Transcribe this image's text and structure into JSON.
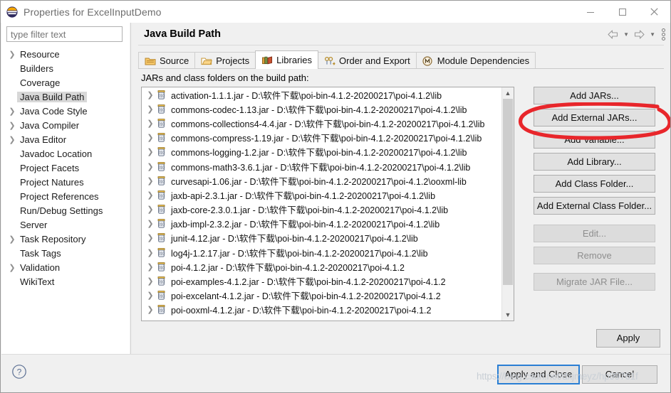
{
  "window": {
    "title": "Properties for ExcelInputDemo",
    "app_icon": "eclipse-icon",
    "minimize_label": "–",
    "maximize_label": "□",
    "close_label": "×"
  },
  "sidebar": {
    "filter_placeholder": "type filter text",
    "filter_value": "",
    "items": [
      {
        "label": "Resource",
        "expandable": true,
        "selected": false
      },
      {
        "label": "Builders",
        "expandable": false,
        "selected": false
      },
      {
        "label": "Coverage",
        "expandable": false,
        "selected": false
      },
      {
        "label": "Java Build Path",
        "expandable": false,
        "selected": true
      },
      {
        "label": "Java Code Style",
        "expandable": true,
        "selected": false
      },
      {
        "label": "Java Compiler",
        "expandable": true,
        "selected": false
      },
      {
        "label": "Java Editor",
        "expandable": true,
        "selected": false
      },
      {
        "label": "Javadoc Location",
        "expandable": false,
        "selected": false
      },
      {
        "label": "Project Facets",
        "expandable": false,
        "selected": false
      },
      {
        "label": "Project Natures",
        "expandable": false,
        "selected": false
      },
      {
        "label": "Project References",
        "expandable": false,
        "selected": false
      },
      {
        "label": "Run/Debug Settings",
        "expandable": false,
        "selected": false
      },
      {
        "label": "Server",
        "expandable": false,
        "selected": false
      },
      {
        "label": "Task Repository",
        "expandable": true,
        "selected": false
      },
      {
        "label": "Task Tags",
        "expandable": false,
        "selected": false
      },
      {
        "label": "Validation",
        "expandable": true,
        "selected": false
      },
      {
        "label": "WikiText",
        "expandable": false,
        "selected": false
      }
    ]
  },
  "main": {
    "page_title": "Java Build Path",
    "nav": {
      "back_icon": "back-arrow-icon",
      "back_dropdown_icon": "chevron-down-icon",
      "forward_icon": "forward-arrow-icon",
      "forward_dropdown_icon": "chevron-down-icon",
      "menu_icon": "vertical-dots-menu-icon"
    },
    "tabs": [
      {
        "label": "Source",
        "icon": "source-folder-icon",
        "active": false
      },
      {
        "label": "Projects",
        "icon": "projects-folder-icon",
        "active": false
      },
      {
        "label": "Libraries",
        "icon": "libraries-books-icon",
        "active": true
      },
      {
        "label": "Order and Export",
        "icon": "order-export-icon",
        "active": false
      },
      {
        "label": "Module Dependencies",
        "icon": "module-dependencies-icon",
        "active": false
      }
    ],
    "caption": "JARs and class folders on the build path:",
    "jars": [
      "activation-1.1.1.jar - D:\\软件下载\\poi-bin-4.1.2-20200217\\poi-4.1.2\\lib",
      "commons-codec-1.13.jar - D:\\软件下载\\poi-bin-4.1.2-20200217\\poi-4.1.2\\lib",
      "commons-collections4-4.4.jar - D:\\软件下载\\poi-bin-4.1.2-20200217\\poi-4.1.2\\lib",
      "commons-compress-1.19.jar - D:\\软件下载\\poi-bin-4.1.2-20200217\\poi-4.1.2\\lib",
      "commons-logging-1.2.jar - D:\\软件下载\\poi-bin-4.1.2-20200217\\poi-4.1.2\\lib",
      "commons-math3-3.6.1.jar - D:\\软件下载\\poi-bin-4.1.2-20200217\\poi-4.1.2\\lib",
      "curvesapi-1.06.jar - D:\\软件下载\\poi-bin-4.1.2-20200217\\poi-4.1.2\\ooxml-lib",
      "jaxb-api-2.3.1.jar - D:\\软件下载\\poi-bin-4.1.2-20200217\\poi-4.1.2\\lib",
      "jaxb-core-2.3.0.1.jar - D:\\软件下载\\poi-bin-4.1.2-20200217\\poi-4.1.2\\lib",
      "jaxb-impl-2.3.2.jar - D:\\软件下载\\poi-bin-4.1.2-20200217\\poi-4.1.2\\lib",
      "junit-4.12.jar - D:\\软件下载\\poi-bin-4.1.2-20200217\\poi-4.1.2\\lib",
      "log4j-1.2.17.jar - D:\\软件下载\\poi-bin-4.1.2-20200217\\poi-4.1.2\\lib",
      "poi-4.1.2.jar - D:\\软件下载\\poi-bin-4.1.2-20200217\\poi-4.1.2",
      "poi-examples-4.1.2.jar - D:\\软件下载\\poi-bin-4.1.2-20200217\\poi-4.1.2",
      "poi-excelant-4.1.2.jar - D:\\软件下载\\poi-bin-4.1.2-20200217\\poi-4.1.2",
      "poi-ooxml-4.1.2.jar - D:\\软件下载\\poi-bin-4.1.2-20200217\\poi-4.1.2"
    ],
    "side_buttons": [
      {
        "label": "Add JARs...",
        "enabled": true
      },
      {
        "label": "Add External JARs...",
        "enabled": true,
        "highlighted": true
      },
      {
        "label": "Add Variable...",
        "enabled": true
      },
      {
        "label": "Add Library...",
        "enabled": true
      },
      {
        "label": "Add Class Folder...",
        "enabled": true
      },
      {
        "label": "Add External Class Folder...",
        "enabled": true
      },
      {
        "label": "Edit...",
        "enabled": false
      },
      {
        "label": "Remove",
        "enabled": false
      },
      {
        "label": "Migrate JAR File...",
        "enabled": false
      }
    ],
    "apply_label": "Apply"
  },
  "footer": {
    "help_icon": "help-question-icon",
    "apply_and_close_label": "Apply and Close",
    "cancel_label": "Cancel"
  },
  "annotation": {
    "shape": "red-ellipse-highlight",
    "color": "#e8262b",
    "target": "Add External JARs..."
  },
  "watermark": {
    "text": "https://blog.csdn.net/dxjmeyz/hp99761f"
  }
}
